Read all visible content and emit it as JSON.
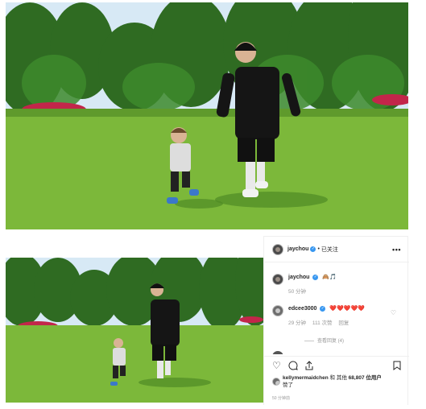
{
  "post": {
    "username": "jaychou",
    "follow_state": "已关注",
    "more_icon": "more-dots-icon"
  },
  "caption": {
    "username": "jaychou",
    "emoji": "🙈🎵",
    "time": "50 分钟"
  },
  "comment": {
    "username": "edcee3000",
    "text": "❤️❤️❤️❤️❤️",
    "time": "29 分钟",
    "likes": "111 次赞",
    "reply": "回复",
    "view_replies": "查看回复 (4)"
  },
  "likes": {
    "liker": "kellymermaidchen",
    "connector": "和 其他",
    "count": "68,807",
    "suffix": "位用户",
    "tail": "赞了"
  },
  "timestamp": "50 分钟前",
  "icons": [
    "heart-icon",
    "comment-icon",
    "share-icon",
    "bookmark-icon"
  ],
  "colors": {
    "verified": "#3897f0",
    "heart": "#ed4956",
    "grass": "#7cb83a",
    "sky": "#d7e9f5"
  }
}
